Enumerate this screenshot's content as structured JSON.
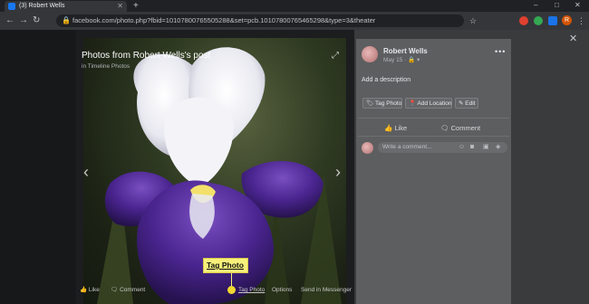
{
  "browser": {
    "tab_title": "(3) Robert Wells",
    "tab_close": "✕",
    "new_tab": "+",
    "url": "facebook.com/photo.php?fbid=10107800765505288&set=pcb.10107800765465298&type=3&theater",
    "window_controls": [
      "–",
      "□",
      "✕"
    ],
    "extension_colors": [
      "#e0402f",
      "#34a853",
      "#1a73e8"
    ],
    "profile_initial": "R"
  },
  "viewer": {
    "album_title": "Photos from Robert Wells's post",
    "album_subtitle": "in Timeline Photos",
    "close_icon": "✕",
    "expand_icon": "⤢",
    "prev_icon": "‹",
    "next_icon": "›",
    "bottom_actions": [
      "Like",
      "Comment",
      "Tag Photo",
      "Options",
      "Send in Messenger"
    ],
    "callout_label": "Tag Photo"
  },
  "panel": {
    "author": "Robert Wells",
    "date": "May 15 · 🔒 ▾",
    "more": "•••",
    "add_description": "Add a description",
    "chips": [
      "Tag Photo",
      "Add Location",
      "Edit"
    ],
    "like": "Like",
    "comment": "Comment",
    "comment_placeholder": "Write a comment..."
  },
  "colors": {
    "accent_callout": "#f7f07a",
    "facebook_blue": "#1877f2"
  }
}
